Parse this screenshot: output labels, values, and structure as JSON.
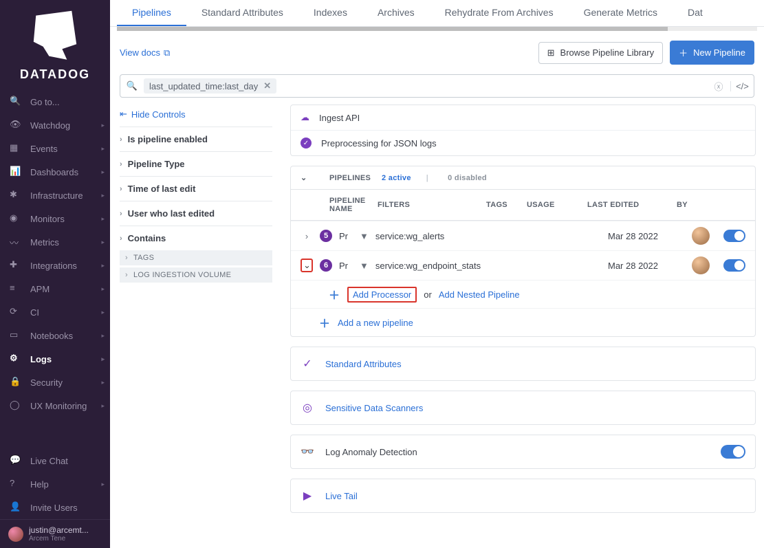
{
  "brand": "DATADOG",
  "sidebar": {
    "items": [
      {
        "label": "Go to...",
        "icon": "search"
      },
      {
        "label": "Watchdog",
        "icon": "binoculars"
      },
      {
        "label": "Events",
        "icon": "calendar"
      },
      {
        "label": "Dashboards",
        "icon": "chart"
      },
      {
        "label": "Infrastructure",
        "icon": "network"
      },
      {
        "label": "Monitors",
        "icon": "shield"
      },
      {
        "label": "Metrics",
        "icon": "line"
      },
      {
        "label": "Integrations",
        "icon": "puzzle"
      },
      {
        "label": "APM",
        "icon": "stack"
      },
      {
        "label": "CI",
        "icon": "ci"
      },
      {
        "label": "Notebooks",
        "icon": "book"
      },
      {
        "label": "Logs",
        "icon": "gear",
        "active": true
      },
      {
        "label": "Security",
        "icon": "lock"
      },
      {
        "label": "UX Monitoring",
        "icon": "globe"
      }
    ],
    "footer": [
      {
        "label": "Live Chat",
        "icon": "chat"
      },
      {
        "label": "Help",
        "icon": "help"
      },
      {
        "label": "Invite Users",
        "icon": "invite"
      }
    ],
    "user": {
      "name": "justin@arcemt...",
      "org": "Arcem Tene"
    }
  },
  "tabs": [
    {
      "label": "Pipelines",
      "active": true
    },
    {
      "label": "Standard Attributes"
    },
    {
      "label": "Indexes"
    },
    {
      "label": "Archives"
    },
    {
      "label": "Rehydrate From Archives"
    },
    {
      "label": "Generate Metrics"
    },
    {
      "label": "Dat"
    }
  ],
  "toolbar": {
    "view_docs": "View docs",
    "browse": "Browse Pipeline Library",
    "new": "New Pipeline"
  },
  "search": {
    "chip": "last_updated_time:last_day"
  },
  "facets": {
    "hide": "Hide Controls",
    "groups": [
      {
        "label": "Is pipeline enabled"
      },
      {
        "label": "Pipeline Type"
      },
      {
        "label": "Time of last edit"
      },
      {
        "label": "User who last edited"
      },
      {
        "label": "Contains"
      }
    ],
    "subs": [
      {
        "label": "TAGS"
      },
      {
        "label": "LOG INGESTION VOLUME"
      }
    ]
  },
  "pre": {
    "ingest": "Ingest API",
    "preproc": "Preprocessing for JSON logs"
  },
  "table": {
    "header": {
      "pipelines": "PIPELINES",
      "active": "2 active",
      "disabled": "0 disabled",
      "name": "PIPELINE NAME",
      "filters": "FILTERS",
      "tags": "TAGS",
      "usage": "USAGE",
      "last": "LAST EDITED",
      "by": "BY"
    },
    "rows": [
      {
        "count": "5",
        "name": "Pr",
        "service": "service:wg_alerts",
        "date": "Mar 28 2022",
        "open": false
      },
      {
        "count": "6",
        "name": "Pr",
        "service": "service:wg_endpoint_stats",
        "date": "Mar 28 2022",
        "open": true
      }
    ],
    "add": {
      "processor": "Add Processor",
      "or": "or",
      "nested": "Add Nested Pipeline",
      "new": "Add a new pipeline"
    }
  },
  "footer_cards": {
    "std": "Standard Attributes",
    "sds": "Sensitive Data Scanners",
    "anomaly": "Log Anomaly Detection",
    "livetail": "Live Tail"
  }
}
